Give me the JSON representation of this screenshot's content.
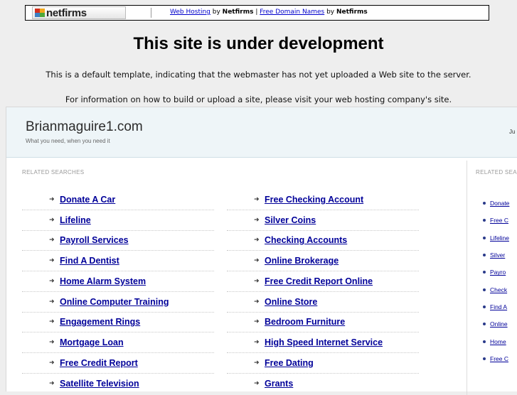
{
  "netfirms_bar": {
    "logo_text": "netfirms",
    "link1": "Web Hosting",
    "by1": " by ",
    "brand1": "Netfirms",
    "sep": " | ",
    "link2": "Free Domain Names",
    "by2": " by ",
    "brand2": "Netfirms"
  },
  "notice": {
    "title": "This site is under development",
    "line1": "This is a default template, indicating that the webmaster has not yet uploaded a Web site to the server.",
    "line2": "For information on how to build or upload a site, please visit your web hosting company's site."
  },
  "parked": {
    "domain": "Brianmaguire1.com",
    "tagline": "What you need, when you need it",
    "header_right": "Ju",
    "section_label": "RELATED SEARCHES",
    "side_label": "RELATED SEA",
    "left_links": [
      "Donate A Car",
      "Lifeline",
      "Payroll Services",
      "Find A Dentist",
      "Home Alarm System",
      "Online Computer Training",
      "Engagement Rings",
      "Mortgage Loan",
      "Free Credit Report",
      "Satellite Television"
    ],
    "right_links": [
      "Free Checking Account",
      "Silver Coins",
      "Checking Accounts",
      "Online Brokerage",
      "Free Credit Report Online",
      "Online Store",
      "Bedroom Furniture",
      "High Speed Internet Service",
      "Free Dating",
      "Grants"
    ],
    "side_links": [
      "Donate",
      "Free C",
      "Lifeline",
      "Silver",
      "Payro",
      "Check",
      "Find A",
      "Online",
      "Home",
      "Free C"
    ]
  },
  "colors": {
    "link": "#000099",
    "header_bg": "#eef5f8",
    "page_bg": "#eeeeee"
  }
}
